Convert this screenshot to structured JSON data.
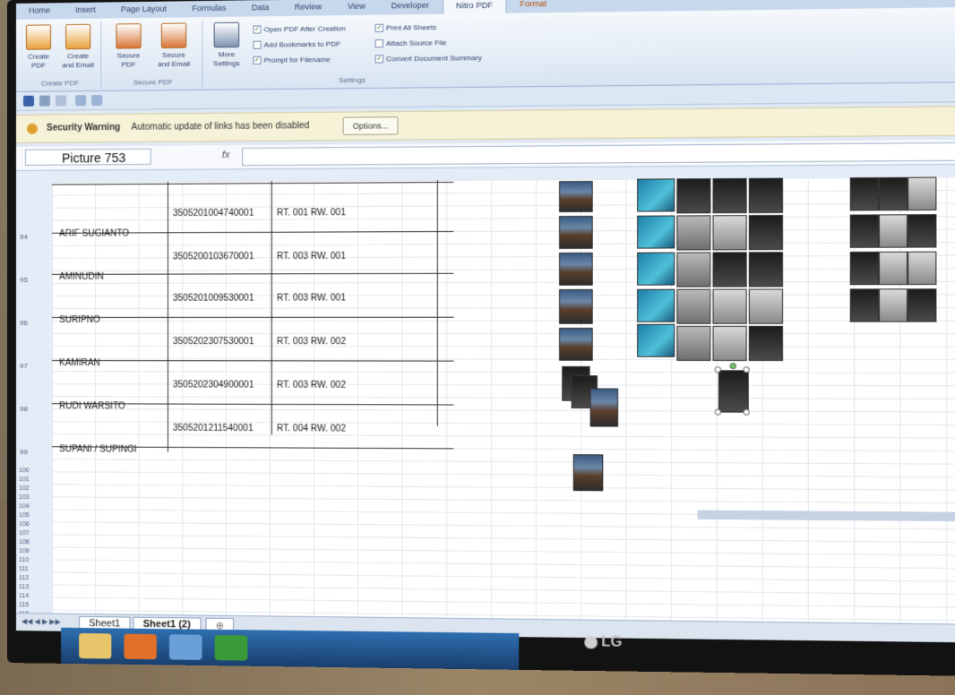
{
  "ribbon": {
    "tabs": [
      "Home",
      "Insert",
      "Page Layout",
      "Formulas",
      "Data",
      "Review",
      "View",
      "Developer",
      "Nitro PDF",
      "Format"
    ],
    "active_tab": "Nitro PDF",
    "groups": {
      "create_pdf": {
        "label": "Create PDF",
        "buttons": [
          "Create PDF",
          "Create and Email"
        ]
      },
      "secure_pdf": {
        "label": "Secure PDF",
        "buttons": [
          "Secure PDF",
          "Secure and Email"
        ]
      },
      "settings": {
        "label": "Settings",
        "more_button": "More Settings",
        "options": [
          {
            "label": "Open PDF After Creation",
            "checked": true
          },
          {
            "label": "Print All Sheets",
            "checked": true
          },
          {
            "label": "Add Bookmarks to PDF",
            "checked": false
          },
          {
            "label": "Attach Source File",
            "checked": false
          },
          {
            "label": "Prompt for Filename",
            "checked": true
          },
          {
            "label": "Convert Document Summary",
            "checked": true
          }
        ]
      }
    }
  },
  "security_warning": {
    "title": "Security Warning",
    "message": "Automatic update of links has been disabled",
    "options_button": "Options..."
  },
  "formula_bar": {
    "name_box": "Picture 753",
    "fx": "fx"
  },
  "rows": [
    {
      "num": "94",
      "name": "ARIF SUGIANTO",
      "id": "3505201004740001",
      "rtrw": "RT. 001 RW. 001"
    },
    {
      "num": "95",
      "name": "AMINUDIN",
      "id": "3505200103670001",
      "rtrw": "RT. 003 RW. 001"
    },
    {
      "num": "96",
      "name": "SURIPNO",
      "id": "3505201009530001",
      "rtrw": "RT. 003 RW. 001"
    },
    {
      "num": "97",
      "name": "KAMIRAN",
      "id": "3505202307530001",
      "rtrw": "RT. 003 RW. 002"
    },
    {
      "num": "98",
      "name": "RUDI WARSITO",
      "id": "3505202304900001",
      "rtrw": "RT. 003 RW. 002"
    },
    {
      "num": "99",
      "name": "SUPANI / SUPINGI",
      "id": "3505201211540001",
      "rtrw": "RT. 004 RW. 002"
    }
  ],
  "empty_rows": [
    "100",
    "101",
    "102",
    "103",
    "104",
    "105",
    "106",
    "107",
    "108",
    "109",
    "110",
    "111",
    "112",
    "113",
    "114",
    "115",
    "116",
    "117"
  ],
  "sheet_tabs": [
    "Sheet1",
    "Sheet1 (2)"
  ],
  "active_sheet": "Sheet1 (2)",
  "monitor_brand": "LG",
  "colors": {
    "ribbon_bg": "#dfe8f3",
    "warning_bg": "#f5f2d8",
    "taskbar": "#1f4f86"
  }
}
